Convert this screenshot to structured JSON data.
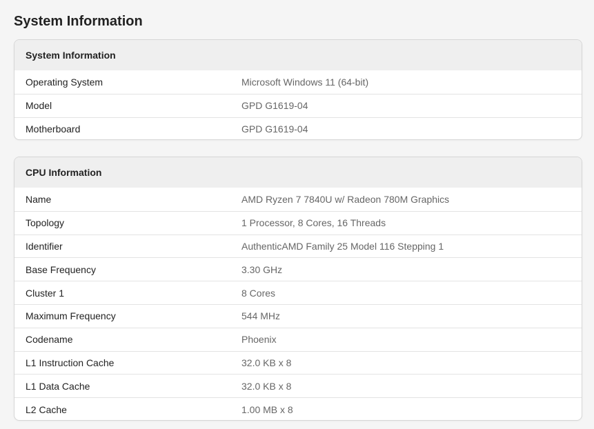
{
  "page": {
    "title": "System Information"
  },
  "system_information": {
    "header": "System Information",
    "rows": [
      {
        "label": "Operating System",
        "value": "Microsoft Windows 11 (64-bit)"
      },
      {
        "label": "Model",
        "value": "GPD G1619-04"
      },
      {
        "label": "Motherboard",
        "value": "GPD G1619-04"
      }
    ]
  },
  "cpu_information": {
    "header": "CPU Information",
    "rows": [
      {
        "label": "Name",
        "value": "AMD Ryzen 7 7840U w/ Radeon 780M Graphics"
      },
      {
        "label": "Topology",
        "value": "1 Processor, 8 Cores, 16 Threads"
      },
      {
        "label": "Identifier",
        "value": "AuthenticAMD Family 25 Model 116 Stepping 1"
      },
      {
        "label": "Base Frequency",
        "value": "3.30 GHz"
      },
      {
        "label": "Cluster 1",
        "value": "8 Cores"
      },
      {
        "label": "Maximum Frequency",
        "value": "544 MHz"
      },
      {
        "label": "Codename",
        "value": "Phoenix"
      },
      {
        "label": "L1 Instruction Cache",
        "value": "32.0 KB x 8"
      },
      {
        "label": "L1 Data Cache",
        "value": "32.0 KB x 8"
      },
      {
        "label": "L2 Cache",
        "value": "1.00 MB x 8"
      }
    ]
  }
}
